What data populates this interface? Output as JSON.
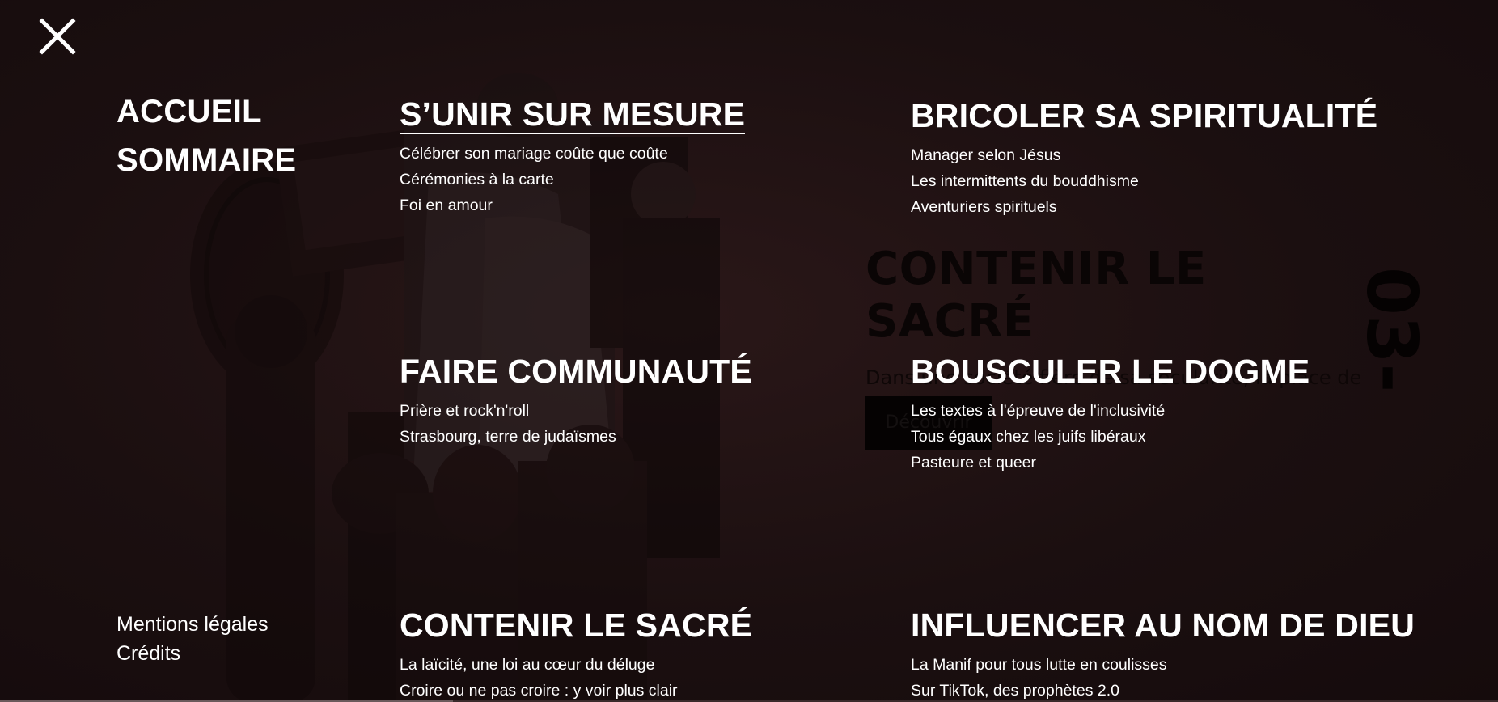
{
  "menu": {
    "main_links": [
      "ACCUEIL",
      "SOMMAIRE"
    ],
    "footer_links": [
      "Mentions légales",
      "Crédits"
    ],
    "sections": [
      {
        "title": "S’UNIR SUR MESURE",
        "active": true,
        "items": [
          "Célébrer son mariage coûte que coûte",
          "Cérémonies à la carte",
          "Foi en amour"
        ]
      },
      {
        "title": "BRICOLER SA SPIRITUALITÉ",
        "items": [
          "Manager selon Jésus",
          "Les intermittents du bouddhisme",
          "Aventuriers spirituels"
        ]
      },
      {
        "title": "FAIRE COMMUNAUTÉ",
        "items": [
          "Prière et rock'n'roll",
          "Strasbourg, terre de judaïsmes"
        ]
      },
      {
        "title": "BOUSCULER LE DOGME",
        "items": [
          "Les textes à l'épreuve de l'inclusivité",
          "Tous égaux chez les juifs libéraux",
          "Pasteure et queer"
        ]
      },
      {
        "title": "CONTENIR LE SACRÉ",
        "items": [
          "La laïcité, une loi au cœur du déluge",
          "Croire ou ne pas croire : y voir plus clair"
        ]
      },
      {
        "title": "INFLUENCER AU NOM DE DIEU",
        "items": [
          "La Manif pour tous lutte en coulisses",
          "Sur TikTok, des prophètes 2.0"
        ]
      }
    ]
  },
  "background": {
    "title": "CONTENIR LE SACRÉ",
    "text": "Dans une société fière de sa sécularité, la place de la religion",
    "button": "Découvrir",
    "number": "03-"
  },
  "icons": {
    "close": "close-icon"
  },
  "colors": {
    "overlay_bg": "#1a0f10",
    "text": "#ffffff",
    "background_text": "#0a0505"
  }
}
